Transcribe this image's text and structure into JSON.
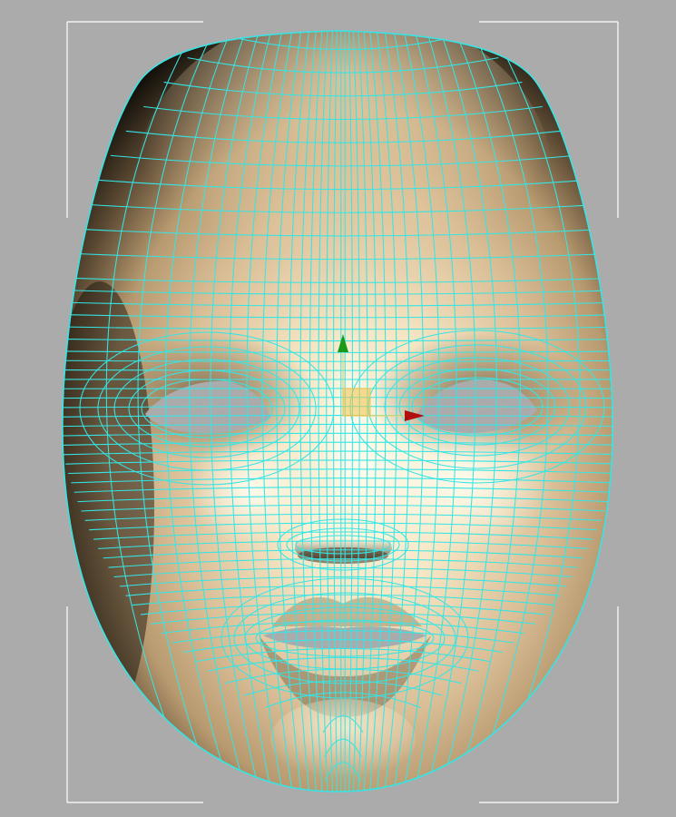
{
  "viewport": {
    "background": "#ababab",
    "frame_color": "#ffffff"
  },
  "mesh": {
    "wireframe_color": "#35e5e5",
    "shading_light": "#fdf5dd",
    "shading_mid": "#dcc09a",
    "shading_dark": "#0b0905",
    "eye_hole_color": "#ababab",
    "mouth_hole_color": "#ababab"
  },
  "gizmo": {
    "y_axis_color": "#1a9a1a",
    "x_axis_color": "#b01010",
    "center_box_color": "#f2c24a"
  }
}
